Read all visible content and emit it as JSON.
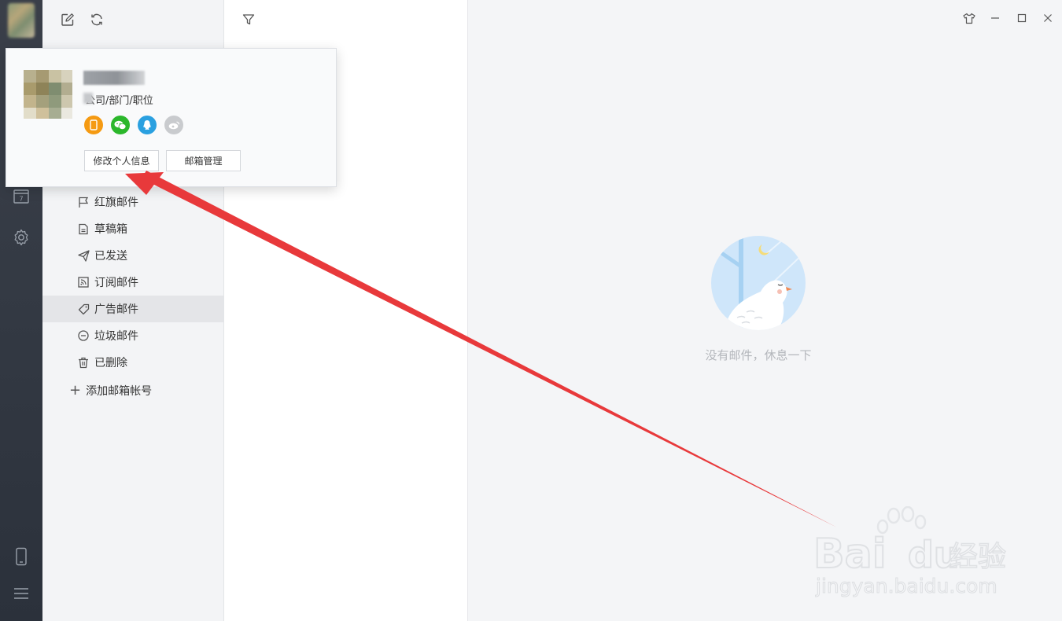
{
  "folders": {
    "items": [
      {
        "label": "红旗邮件",
        "icon": "flag-icon"
      },
      {
        "label": "草稿箱",
        "icon": "draft-icon"
      },
      {
        "label": "已发送",
        "icon": "paper-plane-icon"
      },
      {
        "label": "订阅邮件",
        "icon": "rss-icon"
      },
      {
        "label": "广告邮件",
        "icon": "tag-icon",
        "active": true
      },
      {
        "label": "垃圾邮件",
        "icon": "minus-circle-icon"
      },
      {
        "label": "已删除",
        "icon": "trash-icon"
      }
    ],
    "add_account_label": "添加邮箱帐号"
  },
  "profile_popup": {
    "company_label": "公司/部门/职位",
    "edit_profile_button": "修改个人信息",
    "mailbox_manage_button": "邮箱管理",
    "social_icons": [
      "phone-icon",
      "wechat-icon",
      "qq-icon",
      "weibo-icon"
    ]
  },
  "reader": {
    "empty_text": "没有邮件，休息一下"
  },
  "watermark": {
    "brand": "Baidu经验",
    "url": "jingyan.baidu.com"
  },
  "colors": {
    "rail": "#343a44",
    "arrow": "#e8393b",
    "phone": "#f59a12",
    "wechat": "#2bb72b",
    "qq": "#2aa0e0",
    "weibo": "#c9cbce"
  }
}
